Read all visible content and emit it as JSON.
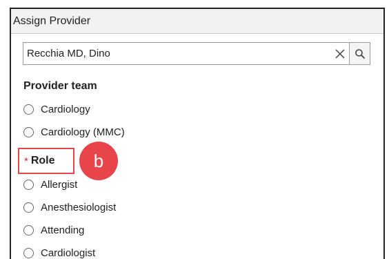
{
  "dialog": {
    "title": "Assign Provider"
  },
  "search": {
    "value": "Recchia MD, Dino",
    "clear_icon": "close-icon",
    "search_icon": "search-icon"
  },
  "provider_team": {
    "heading": "Provider team",
    "options": [
      {
        "label": "Cardiology",
        "selected": false
      },
      {
        "label": "Cardiology (MMC)",
        "selected": false
      }
    ]
  },
  "role": {
    "required_marker": "*",
    "heading": "Role",
    "options": [
      {
        "label": "Allergist",
        "selected": false
      },
      {
        "label": "Anesthesiologist",
        "selected": false
      },
      {
        "label": "Attending",
        "selected": false
      },
      {
        "label": "Cardiologist",
        "selected": false
      }
    ]
  },
  "annotation": {
    "callout_label": "b",
    "highlight_color": "#e8454a"
  }
}
